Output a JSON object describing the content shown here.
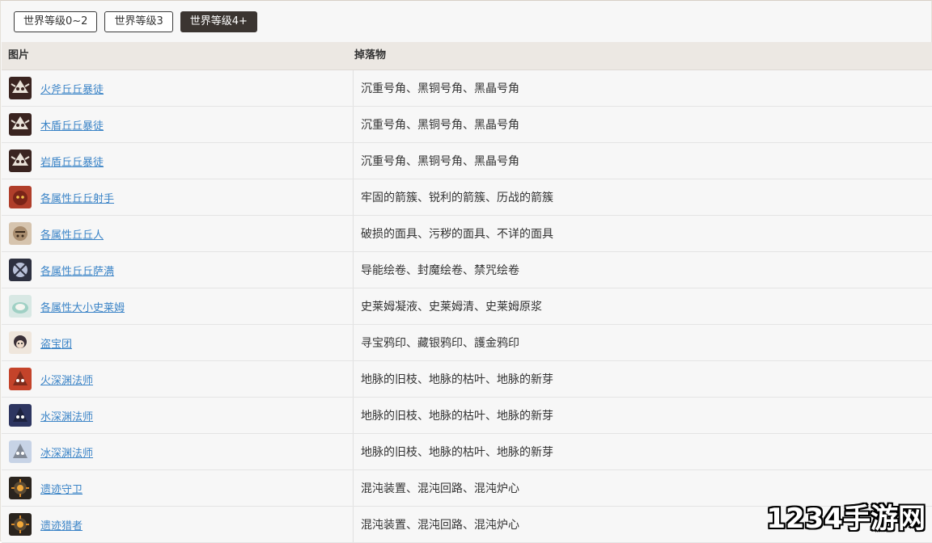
{
  "tabs": [
    {
      "label": "世界等级0~2",
      "active": false
    },
    {
      "label": "世界等级3",
      "active": false
    },
    {
      "label": "世界等级4+",
      "active": true
    }
  ],
  "table": {
    "headers": [
      "图片",
      "掉落物"
    ],
    "rows": [
      {
        "name": "火斧丘丘暴徒",
        "drops": "沉重号角、黑铜号角、黑晶号角",
        "icon": "hilichurl-brute-icon",
        "color": "#3a2420"
      },
      {
        "name": "木盾丘丘暴徒",
        "drops": "沉重号角、黑铜号角、黑晶号角",
        "icon": "hilichurl-brute-icon",
        "color": "#3a2420"
      },
      {
        "name": "岩盾丘丘暴徒",
        "drops": "沉重号角、黑铜号角、黑晶号角",
        "icon": "hilichurl-brute-icon",
        "color": "#3a2420"
      },
      {
        "name": "各属性丘丘射手",
        "drops": "牢固的箭簇、锐利的箭簇、历战的箭簇",
        "icon": "hilichurl-shooter-icon",
        "color": "#b03e2a"
      },
      {
        "name": "各属性丘丘人",
        "drops": "破损的面具、污秽的面具、不详的面具",
        "icon": "hilichurl-icon",
        "color": "#d6c4ae"
      },
      {
        "name": "各属性丘丘萨满",
        "drops": "导能绘卷、封魔绘卷、禁咒绘卷",
        "icon": "hilichurl-shaman-icon",
        "color": "#2d3040"
      },
      {
        "name": "各属性大小史莱姆",
        "drops": "史莱姆凝液、史莱姆清、史莱姆原浆",
        "icon": "slime-icon",
        "color": "#d8e8e4"
      },
      {
        "name": "盗宝团",
        "drops": "寻宝鸦印、藏银鸦印、護金鸦印",
        "icon": "treasure-hoarder-icon",
        "color": "#efe6dc"
      },
      {
        "name": "火深渊法师",
        "drops": "地脉的旧枝、地脉的枯叶、地脉的新芽",
        "icon": "abyss-mage-fire-icon",
        "color": "#c4432a"
      },
      {
        "name": "水深渊法师",
        "drops": "地脉的旧枝、地脉的枯叶、地脉的新芽",
        "icon": "abyss-mage-water-icon",
        "color": "#2d3560"
      },
      {
        "name": "冰深渊法师",
        "drops": "地脉的旧枝、地脉的枯叶、地脉的新芽",
        "icon": "abyss-mage-ice-icon",
        "color": "#c7d3e6"
      },
      {
        "name": "遗迹守卫",
        "drops": "混沌装置、混沌回路、混沌炉心",
        "icon": "ruin-guard-icon",
        "color": "#2a241e"
      },
      {
        "name": "遗迹猎者",
        "drops": "混沌装置、混沌回路、混沌炉心",
        "icon": "ruin-hunter-icon",
        "color": "#2a241e"
      }
    ]
  },
  "watermark": "1234手游网"
}
